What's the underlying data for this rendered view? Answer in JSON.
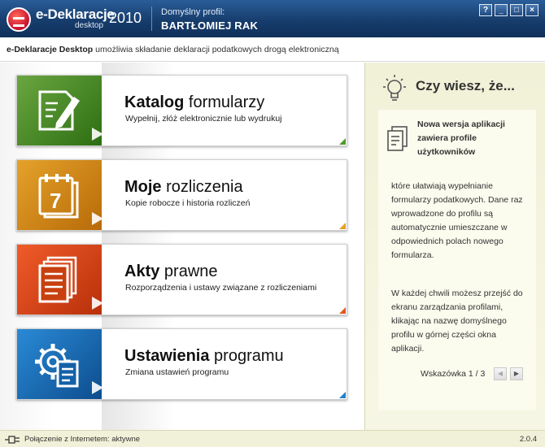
{
  "titlebar": {
    "app_name": "e-Deklaracje",
    "app_sub": "desktop",
    "year": "2010",
    "profile_label": "Domyślny profil:",
    "profile_name": "BARTŁOMIEJ RAK",
    "buttons": [
      "?",
      "_",
      "□",
      "×"
    ]
  },
  "subbar": {
    "app_strong": "e-Deklaracje Desktop",
    "text": " umożliwia składanie deklaracji podatkowych drogą elektroniczną"
  },
  "menu": [
    {
      "title_bold": "Katalog",
      "title_rest": " formularzy",
      "desc": "Wypełnij, złóż elektronicznie lub wydrukuj",
      "icon": "pencil-paper-icon"
    },
    {
      "title_bold": "Moje",
      "title_rest": " rozliczenia",
      "desc": "Kopie robocze i historia rozliczeń",
      "icon": "calendar-icon"
    },
    {
      "title_bold": "Akty",
      "title_rest": " prawne",
      "desc": "Rozporządzenia i ustawy związane z rozliczeniami",
      "icon": "documents-icon"
    },
    {
      "title_bold": "Ustawienia",
      "title_rest": " programu",
      "desc": "Zmiana ustawień programu",
      "icon": "gear-document-icon"
    }
  ],
  "calendar_day": "7",
  "tips": {
    "title": "Czy wiesz, że...",
    "headline": "Nowa wersja aplikacji zawiera profile użytkowników",
    "body1": "które ułatwiają wypełnianie formularzy podatkowych. Dane raz wprowadzone do profilu są automatycznie umieszczane w odpowiednich polach nowego formularza.",
    "body2": "W każdej chwili możesz przejść do ekranu zarządzania profilami, klikając na nazwę domyślnego profilu w górnej części okna aplikacji.",
    "nav_label": "Wskazówka 1 / 3",
    "prev": "◀",
    "next": "▶"
  },
  "status": {
    "connection": "Połączenie z Internetem: aktywne",
    "version": "2.0.4"
  },
  "colors": {
    "titlebar": "#173d6d",
    "katalog": "#4f9a2a",
    "rozliczenia": "#e5a21c",
    "akty": "#e4531c",
    "ustawienia": "#1f7fce",
    "tips_bg": "#f1f1d8"
  }
}
